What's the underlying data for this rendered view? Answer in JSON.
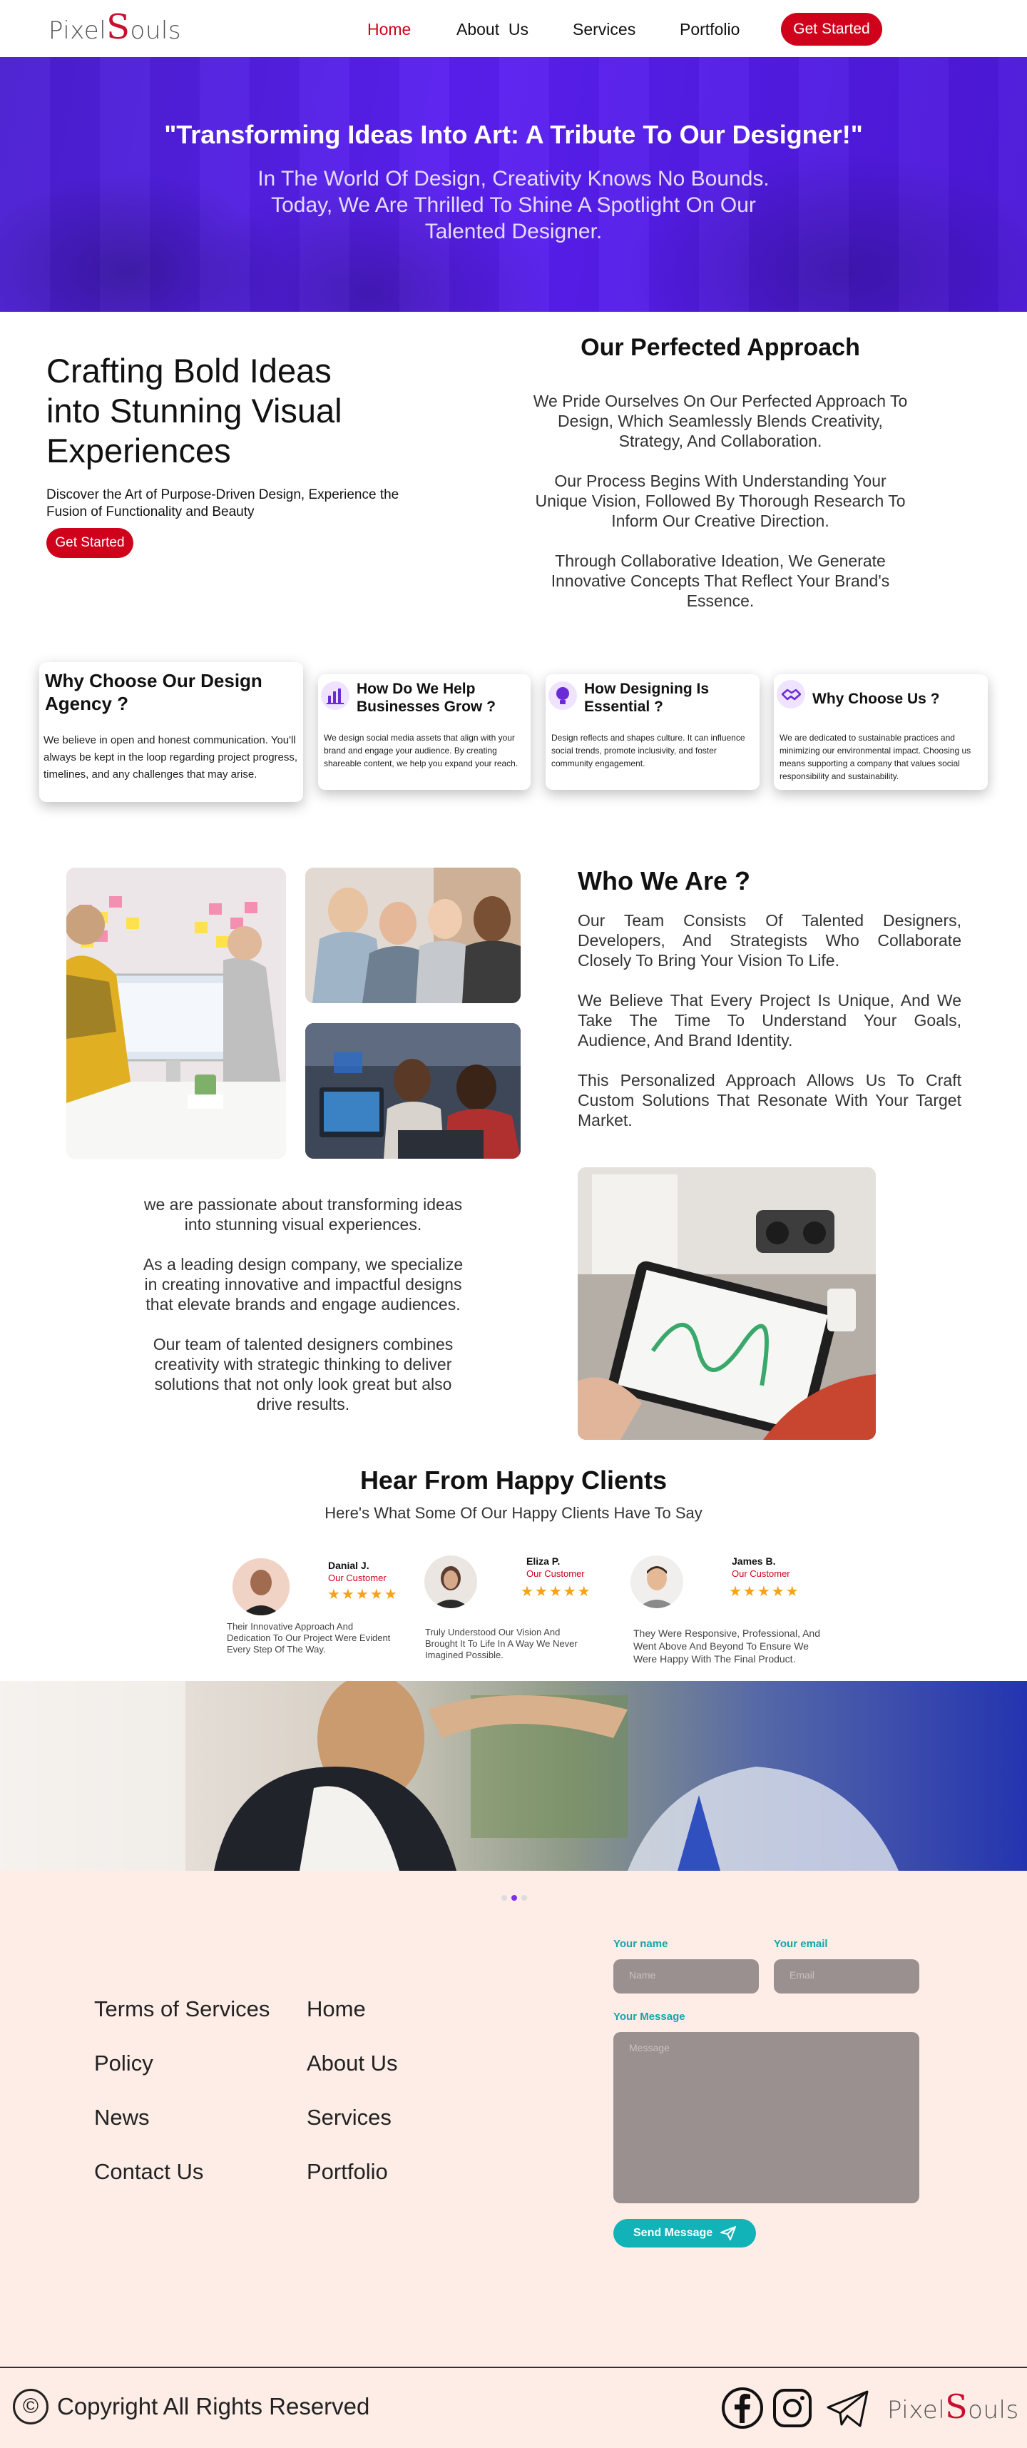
{
  "nav": {
    "logo": "PixelSouls",
    "logo_parts": [
      "Pixel",
      "S",
      "ouls"
    ],
    "links": [
      "Home",
      "About  Us",
      "Services",
      "Portfolio"
    ],
    "active": "Home",
    "cta": "Get Started"
  },
  "hero": {
    "title": "\"Transforming Ideas Into Art: A Tribute To Our Designer!\"",
    "lines": [
      "In The World Of Design, Creativity Knows No Bounds.",
      "Today, We Are Thrilled To Shine A Spotlight On Our",
      "Talented Designer."
    ]
  },
  "intro": {
    "title_lines": [
      "Crafting Bold Ideas",
      "into Stunning Visual",
      "Experiences"
    ],
    "subtitle": "Discover the Art of Purpose-Driven Design, Experience the Fusion of Functionality and Beauty",
    "cta": "Get Started"
  },
  "approach": {
    "title": "Our Perfected Approach",
    "paragraphs": [
      "We Pride Ourselves On Our Perfected Approach To Design, Which Seamlessly Blends Creativity, Strategy, And Collaboration.",
      "Our Process Begins With Understanding Your Unique Vision, Followed By Thorough Research To Inform Our Creative Direction.",
      "Through Collaborative Ideation, We Generate Innovative Concepts That Reflect Your Brand's Essence."
    ]
  },
  "cards": [
    {
      "title": "Why Choose Our Design Agency ?",
      "text": "We believe in open and honest communication. You'll always be kept in the loop regarding project progress, timelines, and any challenges that may arise."
    },
    {
      "title": "How Do We Help Businesses Grow ?",
      "icon": "chart-icon",
      "text": "We design social media assets that align with your brand and engage your audience. By creating shareable content, we help you expand your reach."
    },
    {
      "title": "How Designing Is Essential ?",
      "icon": "bulb-icon",
      "text": "Design reflects and shapes culture. It can influence social trends, promote inclusivity, and foster community engagement."
    },
    {
      "title": "Why Choose Us ?",
      "icon": "handshake-icon",
      "text": "We are dedicated to sustainable practices and minimizing our environmental impact. Choosing us means supporting a company that values social responsibility and sustainability."
    }
  ],
  "who": {
    "title": "Who We Are ?",
    "paragraphs": [
      "Our Team Consists Of Talented Designers, Developers, And Strategists Who Collaborate Closely To Bring Your Vision To Life.",
      "We Believe That Every Project Is Unique, And We Take The Time To Understand Your Goals, Audience, And Brand Identity.",
      "This Personalized Approach Allows Us To Craft Custom Solutions That Resonate With Your Target Market."
    ]
  },
  "passion": {
    "paragraphs": [
      "we are passionate about transforming ideas into stunning visual experiences.",
      "As a leading design company, we specialize in creating innovative and impactful designs that elevate brands and engage audiences.",
      "Our team of talented designers combines creativity with strategic thinking to deliver solutions that not only look great but also drive results."
    ]
  },
  "testimonials": {
    "title": "Hear From Happy Clients",
    "subtitle": "Here's What Some Of Our Happy Clients Have To Say",
    "items": [
      {
        "name": "Danial J.",
        "role": "Our Customer",
        "stars": "★★★★★",
        "rating": 5,
        "quote": "Their Innovative Approach And Dedication To Our Project Were Evident Every Step Of The Way."
      },
      {
        "name": "Eliza P.",
        "role": "Our Customer",
        "stars": "★★★★★",
        "rating": 5,
        "quote": "Truly Understood Our Vision And Brought It To Life In A Way We Never Imagined Possible."
      },
      {
        "name": "James B.",
        "role": "Our Customer",
        "stars": "★★★★★",
        "rating": 5,
        "quote": "They Were Responsive, Professional, And Went Above And Beyond To Ensure We Were Happy With The Final Product."
      }
    ]
  },
  "footer": {
    "col1": [
      "Terms of Services",
      "Policy",
      "News",
      "Contact Us"
    ],
    "col2": [
      "Home",
      "About Us",
      "Services",
      "Portfolio"
    ],
    "form": {
      "name_label": "Your name",
      "email_label": "Your email",
      "message_label": "Your Message",
      "name_placeholder": "Name",
      "email_placeholder": "Email",
      "message_placeholder": "Message",
      "send": "Send Message"
    },
    "copyright_symbol": "©",
    "copyright": "Copyright All Rights Reserved",
    "social_icons": [
      "facebook-icon",
      "instagram-icon",
      "telegram-icon"
    ],
    "logo_parts": [
      "Pixel",
      "S",
      "ouls"
    ]
  },
  "colors": {
    "brand_red": "#d0021b",
    "hero_purple": "#5a1ff0",
    "teal": "#12b3b8",
    "footer_bg": "#fdede6",
    "star": "#f6a21a"
  }
}
